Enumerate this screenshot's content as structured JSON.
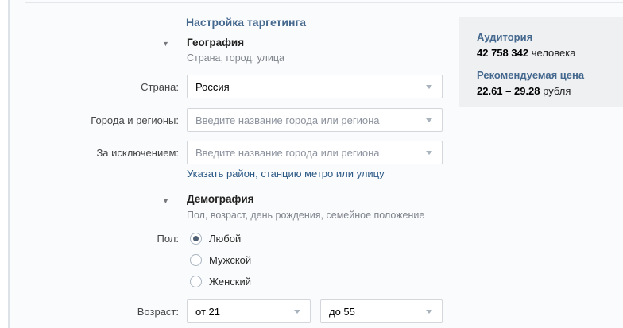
{
  "header": {
    "title": "Настройка таргетинга"
  },
  "geography": {
    "title": "География",
    "subtitle": "Страна, город, улица",
    "country_label": "Страна:",
    "country_value": "Россия",
    "cities_label": "Города и регионы:",
    "cities_placeholder": "Введите название города или региона",
    "exclude_label": "За исключением:",
    "exclude_placeholder": "Введите название города или региона",
    "refine_link": "Указать район, станцию метро или улицу"
  },
  "demography": {
    "title": "Демография",
    "subtitle": "Пол, возраст, день рождения, семейное положение",
    "gender_label": "Пол:",
    "gender_options": [
      {
        "label": "Любой",
        "selected": true
      },
      {
        "label": "Мужской",
        "selected": false
      },
      {
        "label": "Женский",
        "selected": false
      }
    ],
    "age_label": "Возраст:",
    "age_from": "от 21",
    "age_to": "до 55"
  },
  "summary": {
    "audience_title": "Аудитория",
    "audience_value": "42 758 342",
    "audience_unit": "человека",
    "price_title": "Рекомендуемая цена",
    "price_value": "22.61 – 29.28",
    "price_unit": "рубля"
  },
  "colors": {
    "header_blue": "#45688e",
    "link_blue": "#2a5885",
    "summary_box_bg": "#eef0f2",
    "control_border": "#d3d7dc",
    "page_bg": "#fafbfc"
  }
}
